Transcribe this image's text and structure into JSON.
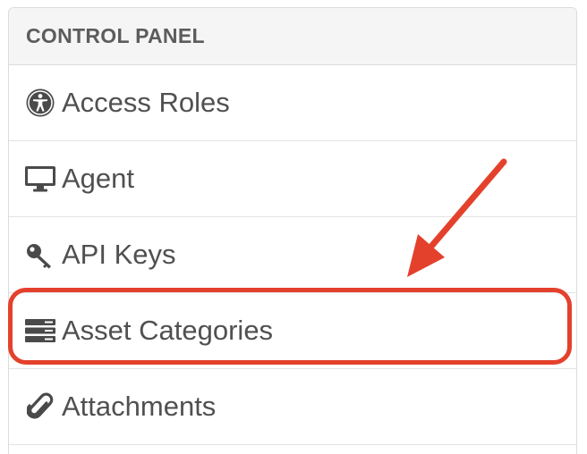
{
  "panel": {
    "title": "CONTROL PANEL",
    "items": [
      {
        "label": "Access Roles",
        "icon": "universal-access-icon"
      },
      {
        "label": "Agent",
        "icon": "monitor-icon"
      },
      {
        "label": "API Keys",
        "icon": "key-icon"
      },
      {
        "label": "Asset Categories",
        "icon": "server-stack-icon"
      },
      {
        "label": "Attachments",
        "icon": "paperclip-icon"
      }
    ]
  },
  "annotation": {
    "highlighted_item": "Asset Categories",
    "color": "#e4412c"
  },
  "colors": {
    "header_bg": "#f5f5f5",
    "text": "#505050",
    "icon": "#4a4a4a",
    "border": "#dcdcdc"
  }
}
